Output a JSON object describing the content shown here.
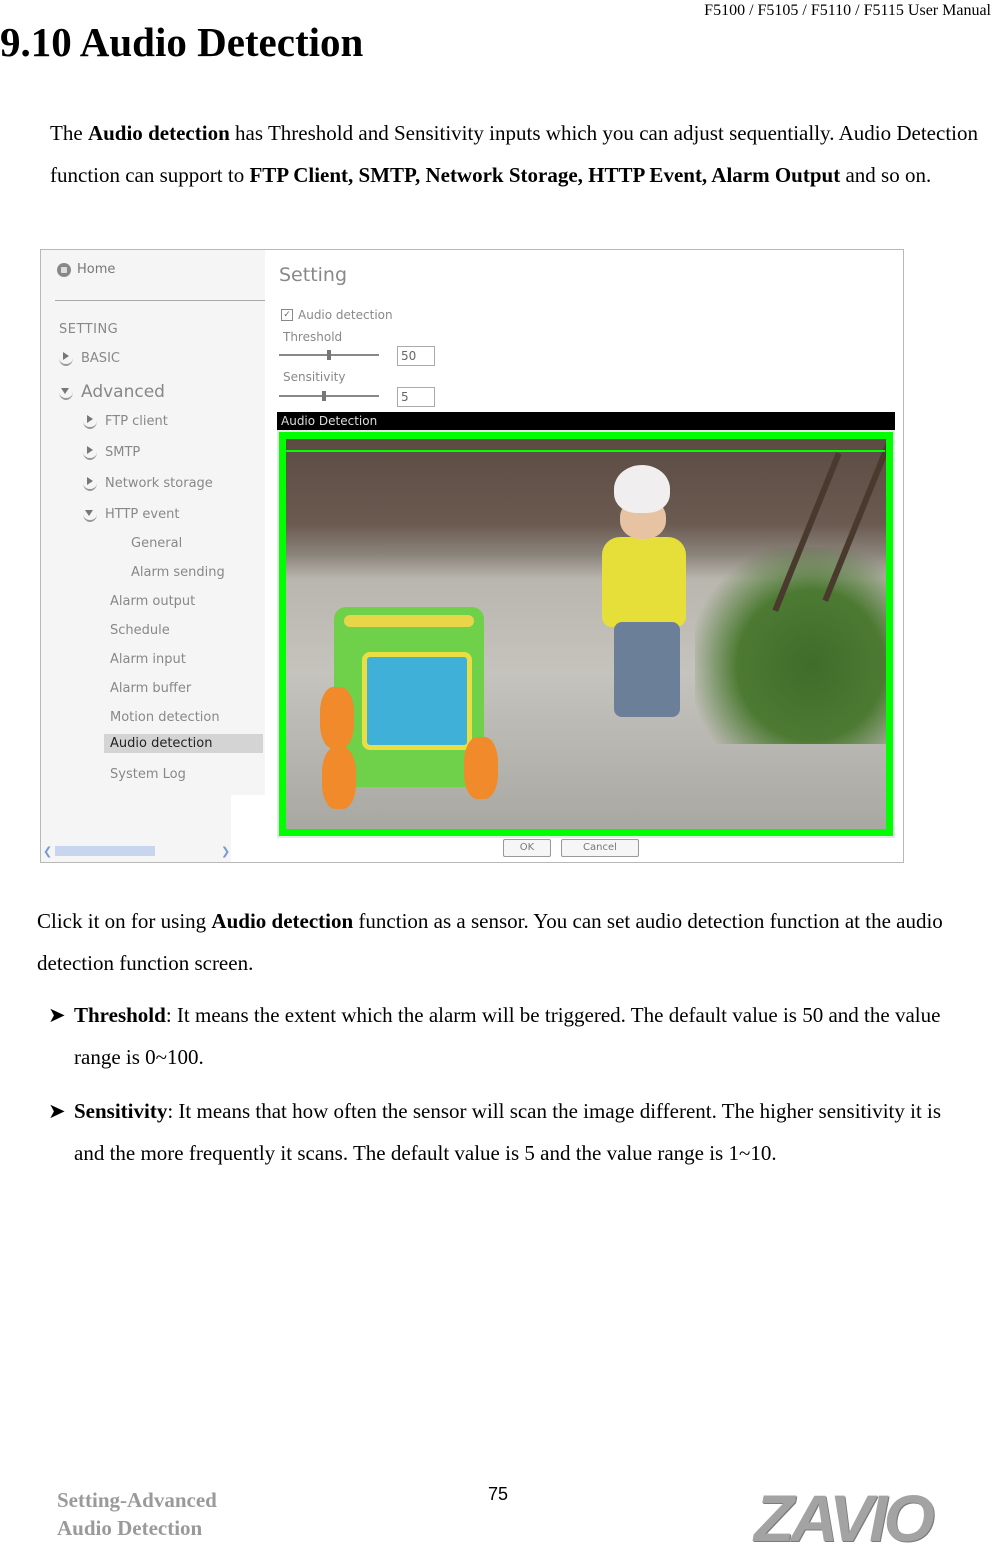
{
  "header": {
    "manual": "F5100 / F5105 / F5110 / F5115 User Manual"
  },
  "title": "9.10 Audio Detection",
  "intro": {
    "t1": "The ",
    "b1": "Audio detection",
    "t2": " has Threshold and Sensitivity inputs which you can adjust sequentially. Audio Detection function can support to ",
    "b2": "FTP Client, SMTP, Network Storage, HTTP Event, Alarm Output",
    "t3": " and so on."
  },
  "screenshot": {
    "sidebar": {
      "home": "Home",
      "section": "SETTING",
      "items": [
        {
          "label": "BASIC",
          "level": 0,
          "expanded": false
        },
        {
          "label": "Advanced",
          "level": 0,
          "expanded": true
        },
        {
          "label": "FTP client",
          "level": 1,
          "expanded": false
        },
        {
          "label": "SMTP",
          "level": 1,
          "expanded": false
        },
        {
          "label": "Network storage",
          "level": 1,
          "expanded": false
        },
        {
          "label": "HTTP event",
          "level": 1,
          "expanded": true
        },
        {
          "label": "General",
          "level": 2
        },
        {
          "label": "Alarm sending",
          "level": 2
        },
        {
          "label": "Alarm output",
          "level": 1
        },
        {
          "label": "Schedule",
          "level": 1
        },
        {
          "label": "Alarm input",
          "level": 1
        },
        {
          "label": "Alarm buffer",
          "level": 1
        },
        {
          "label": "Motion detection",
          "level": 1
        },
        {
          "label": "Audio detection",
          "level": 1,
          "active": true
        },
        {
          "label": "System Log",
          "level": 1
        }
      ]
    },
    "main": {
      "heading": "Setting",
      "checkbox_label": "Audio detection",
      "checkbox_checked": true,
      "threshold_label": "Threshold",
      "threshold_value": "50",
      "threshold_fraction": 0.5,
      "sensitivity_label": "Sensitivity",
      "sensitivity_value": "5",
      "sensitivity_fraction": 0.45,
      "video_title": "Audio Detection",
      "ok": "OK",
      "cancel": "Cancel",
      "detect_color": "#00ff00"
    }
  },
  "para2": {
    "t1": "Click it on for using ",
    "b1": "Audio detection",
    "t2": " function as a sensor. You can set audio detection function at the audio detection function screen."
  },
  "bullets": [
    {
      "term": "Threshold",
      "text": ": It means the extent which the alarm will be triggered. The default value is 50 and the value range is 0~100."
    },
    {
      "term": "Sensitivity",
      "text": ": It means that how often the sensor will scan the image different. The higher sensitivity it is and the more frequently it scans.  The default value is 5 and the value range is 1~10."
    }
  ],
  "footer": {
    "section_line1": "Setting-Advanced",
    "section_line2": "Audio Detection",
    "page": "75",
    "logo": "ZAVIO"
  }
}
